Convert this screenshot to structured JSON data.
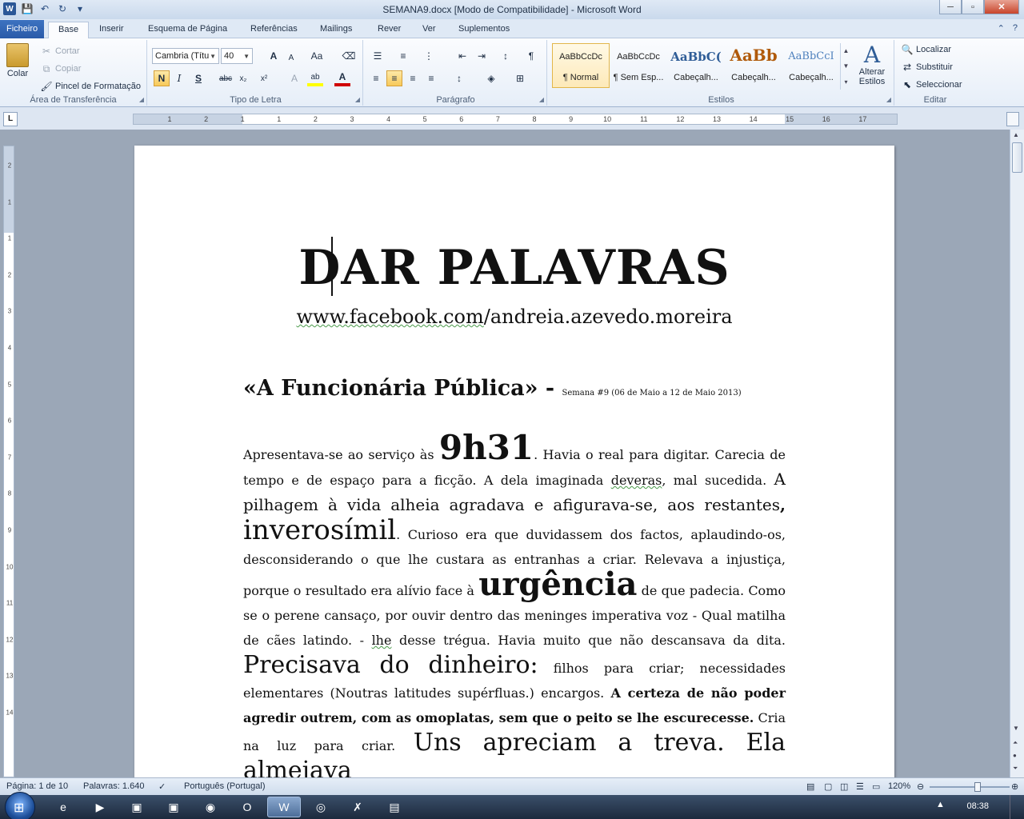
{
  "window": {
    "title": "SEMANA9.docx [Modo de Compatibilidade]  -  Microsoft Word",
    "minimize": "─",
    "maximize": "▫",
    "close": "✕"
  },
  "tabs": [
    "Ficheiro",
    "Base",
    "Inserir",
    "Esquema de Página",
    "Referências",
    "Mailings",
    "Rever",
    "Ver",
    "Suplementos"
  ],
  "ribbon": {
    "clipboard": {
      "label": "Área de Transferência",
      "paste": "Colar",
      "cut": "Cortar",
      "copy": "Copiar",
      "format_painter": "Pincel de Formatação"
    },
    "font": {
      "label": "Tipo de Letra",
      "font_name": "Cambria (Títu",
      "font_size": "40",
      "bold": "N",
      "italic": "I",
      "underline": "S",
      "strike": "abc",
      "subscript": "x₂",
      "superscript": "x²",
      "grow": "A",
      "shrink": "A",
      "case": "Aa",
      "highlight": "ab",
      "color": "A"
    },
    "paragraph": {
      "label": "Parágrafo",
      "show_marks": "¶"
    },
    "styles": {
      "label": "Estilos",
      "items": [
        {
          "preview": "AaBbCcDc",
          "name": "¶ Normal"
        },
        {
          "preview": "AaBbCcDc",
          "name": "¶ Sem Esp..."
        },
        {
          "preview": "AaBbC(",
          "name": "Cabeçalh..."
        },
        {
          "preview": "AaBb",
          "name": "Cabeçalh..."
        },
        {
          "preview": "AaBbCcI",
          "name": "Cabeçalh..."
        }
      ],
      "change_styles": "Alterar Estilos"
    },
    "editing": {
      "label": "Editar",
      "find": "Localizar",
      "replace": "Substituir",
      "select": "Seleccionar"
    }
  },
  "ruler": {
    "h_ticks": [
      "1",
      "2",
      "1",
      "1",
      "2",
      "3",
      "4",
      "5",
      "6",
      "7",
      "8",
      "9",
      "10",
      "11",
      "12",
      "13",
      "14",
      "15",
      "16",
      "17"
    ],
    "v_ticks": [
      "2",
      "1",
      "1",
      "2",
      "3",
      "4",
      "5",
      "6",
      "7",
      "8",
      "9",
      "10",
      "11",
      "12",
      "13",
      "14"
    ]
  },
  "document": {
    "title": "DAR PALAVRAS",
    "url_a": "www.facebook.com",
    "url_b": "/andreia.azevedo.moreira",
    "heading": "«A Funcionária Pública» - ",
    "heading_small": "Semana #9 (06 de Maio  a 12 de Maio  2013)",
    "p1": "Apresentava-se ao serviço às ",
    "p_time": "9h31",
    "p2": ". Havia o real para digitar. Carecia de tempo e de espaço para a ficção. A dela imaginada ",
    "p_deveras": "deveras",
    "p3": ", mal sucedida. ",
    "p4": "A pilhagem à vida alheia agradava e afigurava-se, aos restantes",
    "p4b": ", ",
    "p_inv": "inverosímil",
    "p5": ". Curioso era que duvidassem dos factos, aplaudindo-os, desconsiderando o que lhe custara as entranhas a criar. Relevava a injustiça, porque o resultado era alívio face à ",
    "p_urg": "urgência",
    "p6": " de que padecia. Como se o perene cansaço, por ouvir dentro das meninges imperativa voz - Qual matilha de cães latindo. - ",
    "p_lhe": "lhe",
    "p7": " desse trégua. Havia muito que não descansava da dita. ",
    "p_prec": "Precisava do dinheiro:",
    "p8": " filhos para criar; necessidades elementares (Noutras latitudes supérfluas.) encargos. ",
    "p_bold": "A certeza de não poder agredir outrem, com as omoplatas, sem que o peito se lhe escurecesse.",
    "p9": " Cria na luz para criar. ",
    "p_uns": "Uns apreciam a treva. Ela almejava"
  },
  "status": {
    "page": "Página: 1 de 10",
    "words": "Palavras: 1.640",
    "language": "Português (Portugal)",
    "zoom": "120%",
    "zoom_level": 0.6
  },
  "taskbar": {
    "clock": "08:38"
  }
}
